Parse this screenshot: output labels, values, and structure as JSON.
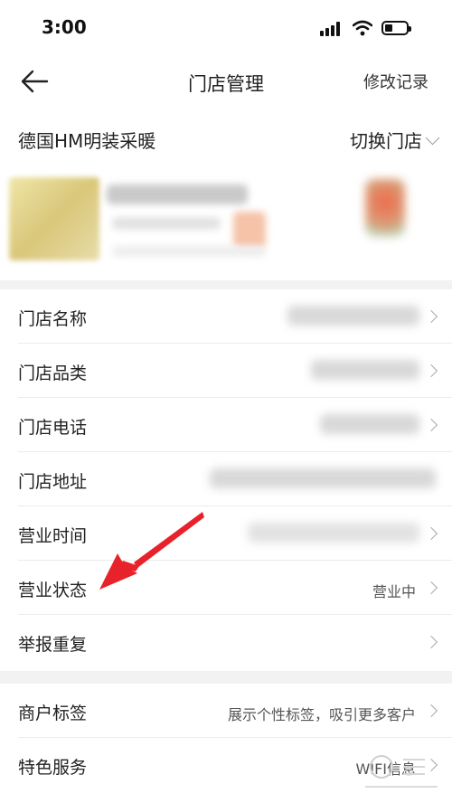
{
  "status_bar": {
    "time": "3:00"
  },
  "header": {
    "title": "门店管理",
    "history_label": "修改记录"
  },
  "store_bar": {
    "store_name": "德国HM明装采暖",
    "switch_label": "切换门店"
  },
  "section1": [
    {
      "label": "门店名称",
      "value": ""
    },
    {
      "label": "门店品类",
      "value": ""
    },
    {
      "label": "门店电话",
      "value": ""
    },
    {
      "label": "门店地址",
      "value": ""
    },
    {
      "label": "营业时间",
      "value": ""
    },
    {
      "label": "营业状态",
      "value": "营业中"
    },
    {
      "label": "举报重复",
      "value": ""
    }
  ],
  "section2": [
    {
      "label": "商户标签",
      "value": "展示个性标签，吸引更多客户"
    },
    {
      "label": "特色服务",
      "value": "WIFI信息"
    }
  ],
  "colors": {
    "annotation_red": "#e8222a",
    "background": "#f2f2f2"
  },
  "icons": [
    "back-arrow-icon",
    "chevron-down-icon",
    "chevron-right-icon",
    "signal-icon",
    "wifi-icon",
    "battery-icon"
  ]
}
